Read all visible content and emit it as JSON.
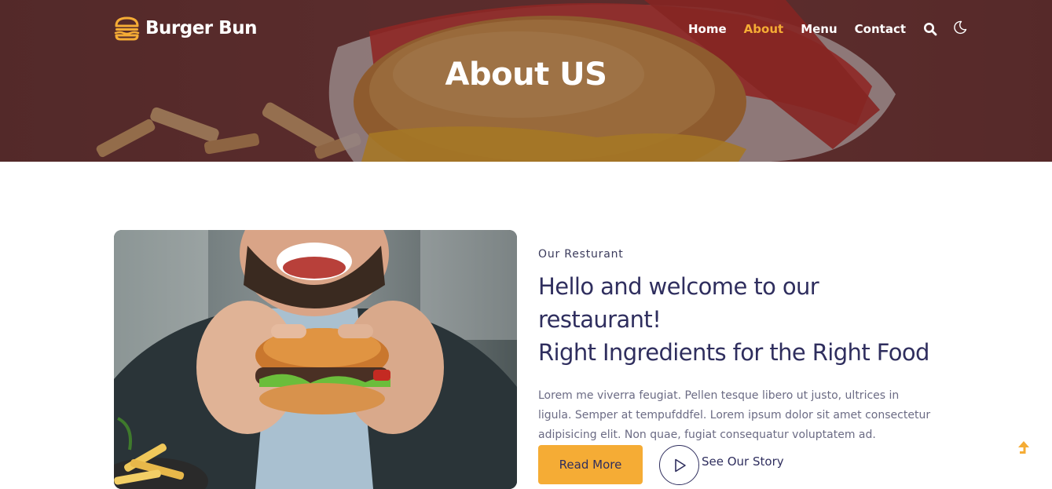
{
  "brand": {
    "name": "Burger Bun",
    "icon": "burger-icon",
    "accent": "#f5ac35"
  },
  "nav": {
    "items": [
      {
        "label": "Home",
        "active": false
      },
      {
        "label": "About",
        "active": true
      },
      {
        "label": "Menu",
        "active": false
      },
      {
        "label": "Contact",
        "active": false
      }
    ],
    "icons": [
      "search-icon",
      "moon-icon"
    ]
  },
  "hero": {
    "title": "About US"
  },
  "about": {
    "eyebrow": "Our Resturant",
    "heading_line1": "Hello and welcome to our restaurant!",
    "heading_line2": "Right Ingredients for the Right Food",
    "description": "Lorem me viverra feugiat. Pellen tesque libero ut justo, ultrices in ligula. Semper at tempufddfel. Lorem ipsum dolor sit amet consectetur adipisicing elit. Non quae, fugiat consequatur voluptatem ad.",
    "read_more_label": "Read More",
    "story_label": "See Our Story"
  },
  "colors": {
    "heading": "#2f2e5e",
    "body": "#6b6b84",
    "hero_bg": "#6b3a3a"
  }
}
